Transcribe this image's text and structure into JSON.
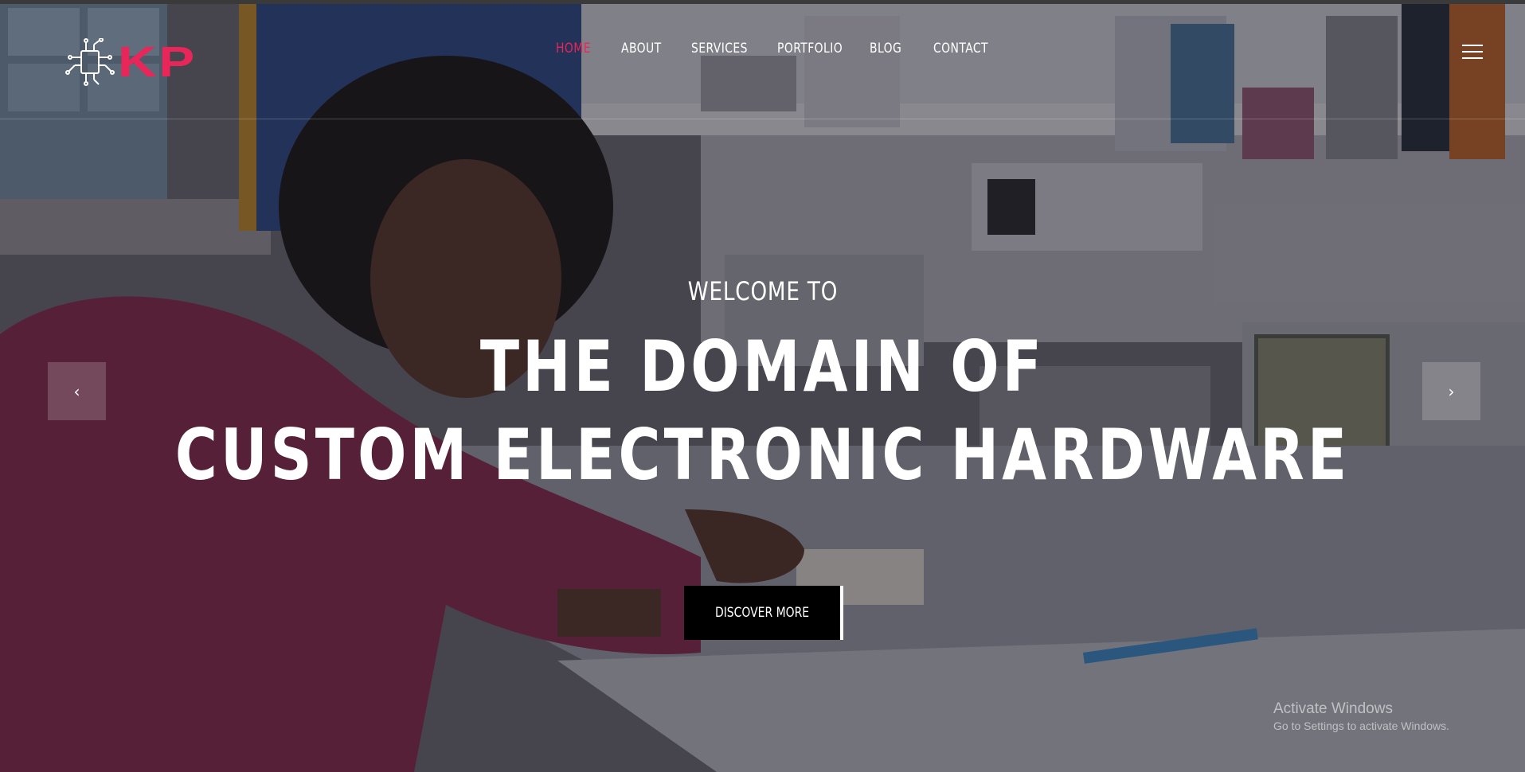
{
  "brand": {
    "logo_text": "KP",
    "accent": "#e8265a"
  },
  "nav": {
    "items": [
      {
        "label": "HOME",
        "active": true
      },
      {
        "label": "ABOUT",
        "active": false
      },
      {
        "label": "SERVICES",
        "active": false
      },
      {
        "label": "PORTFOLIO",
        "active": false
      },
      {
        "label": "BLOG",
        "active": false
      },
      {
        "label": "CONTACT",
        "active": false
      }
    ],
    "menu_icon": "hamburger-icon"
  },
  "hero": {
    "kicker": "WELCOME TO",
    "title_line1": "THE DOMAIN OF",
    "title_line2": "CUSTOM ELECTRONIC HARDWARE",
    "cta_label": "DISCOVER MORE",
    "prev_icon": "chevron-left-icon",
    "next_icon": "chevron-right-icon",
    "prev_glyph": "‹",
    "next_glyph": "›"
  },
  "os_watermark": {
    "line1": "Activate Windows",
    "line2": "Go to Settings to activate Windows."
  }
}
